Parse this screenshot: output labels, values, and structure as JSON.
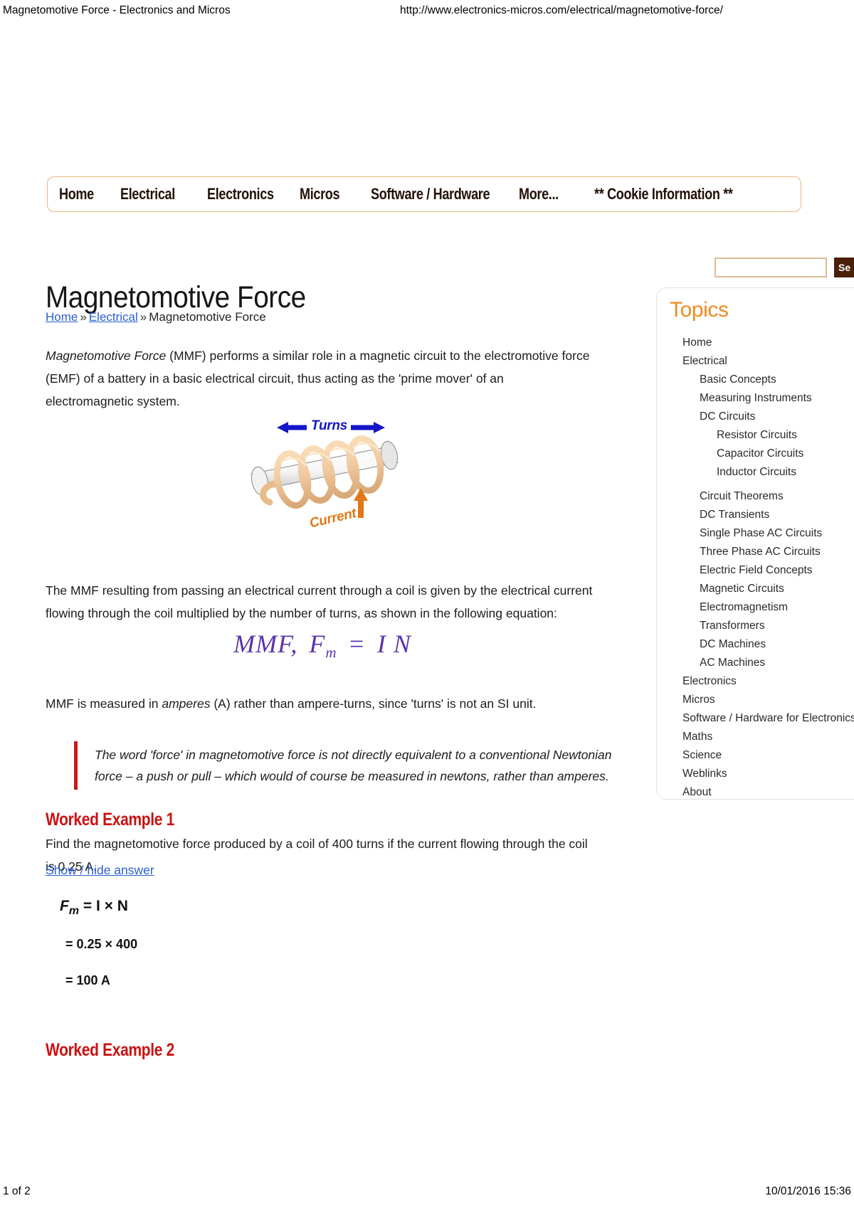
{
  "print": {
    "header_title": "Magnetomotive Force - Electronics and Micros",
    "header_url": "http://www.electronics-micros.com/electrical/magnetomotive-force/",
    "footer_page": "1 of 2",
    "footer_date": "10/01/2016 15:36"
  },
  "nav": {
    "items": [
      {
        "label": "Home"
      },
      {
        "label": "Electrical"
      },
      {
        "label": "Electronics"
      },
      {
        "label": "Micros"
      },
      {
        "label": "Software / Hardware"
      },
      {
        "label": "More..."
      },
      {
        "label": "** Cookie Information **"
      }
    ]
  },
  "main": {
    "title": "Magnetomotive Force",
    "breadcrumb": {
      "home": "Home",
      "sep1": "»",
      "electrical": "Electrical",
      "sep2": "»",
      "current": "Magnetomotive Force"
    },
    "intro_italic": "Magnetomotive Force",
    "intro_rest": " (MMF) performs a similar role in a magnetic circuit to the electromotive force (EMF) of a battery in a basic electrical circuit, thus acting as the 'prime mover' of an electromagnetic system.",
    "figure": {
      "turns_label": "Turns",
      "current_label": "Current"
    },
    "para_result": "The MMF resulting from passing an electrical current through a coil is given by the electrical current flowing through the coil multiplied by the number of turns, as shown in the following equation:",
    "equation": {
      "lhs": "MMF,",
      "symbol": "F",
      "subscript": "m",
      "equals": "=",
      "rhs": "I N"
    },
    "para_amperes_pre": "MMF is measured in ",
    "para_amperes_italic": "amperes",
    "para_amperes_post": " (A) rather than ampere-turns, since 'turns' is not an SI unit.",
    "note": "The word 'force' in magnetomotive force is not directly equivalent to a conventional Newtonian force – a push or pull – which would of course be measured in newtons, rather than amperes.",
    "worked_example_1": {
      "heading": "Worked Example 1",
      "question": "Find the magnetomotive force produced by a coil of 400 turns if the current flowing through the coil is 0.25 A.",
      "toggle": "Show / hide answer",
      "answer_symbol": "F",
      "answer_subscript": "m",
      "answer_formula": " = I × N",
      "answer_step2": "= 0.25 × 400",
      "answer_step3": "= 100 A"
    },
    "worked_example_2": {
      "heading": "Worked Example 2"
    }
  },
  "sidebar": {
    "search": {
      "value": "",
      "placeholder": "",
      "button_label": "Se"
    },
    "title": "Topics",
    "items": [
      {
        "label": "Home",
        "level": 0,
        "gap": false
      },
      {
        "label": "Electrical",
        "level": 0,
        "gap": false
      },
      {
        "label": "Basic Concepts",
        "level": 1,
        "gap": false
      },
      {
        "label": "Measuring Instruments",
        "level": 1,
        "gap": false
      },
      {
        "label": "DC Circuits",
        "level": 1,
        "gap": false
      },
      {
        "label": "Resistor Circuits",
        "level": 2,
        "gap": false
      },
      {
        "label": "Capacitor Circuits",
        "level": 2,
        "gap": false
      },
      {
        "label": "Inductor Circuits",
        "level": 2,
        "gap": false
      },
      {
        "label": "Circuit Theorems",
        "level": 1,
        "gap": true
      },
      {
        "label": "DC Transients",
        "level": 1,
        "gap": false
      },
      {
        "label": "Single Phase AC Circuits",
        "level": 1,
        "gap": false
      },
      {
        "label": "Three Phase AC Circuits",
        "level": 1,
        "gap": false
      },
      {
        "label": "Electric Field Concepts",
        "level": 1,
        "gap": false
      },
      {
        "label": "Magnetic Circuits",
        "level": 1,
        "gap": false
      },
      {
        "label": "Electromagnetism",
        "level": 1,
        "gap": false
      },
      {
        "label": "Transformers",
        "level": 1,
        "gap": false
      },
      {
        "label": "DC Machines",
        "level": 1,
        "gap": false
      },
      {
        "label": "AC Machines",
        "level": 1,
        "gap": false
      },
      {
        "label": "Electronics",
        "level": 0,
        "gap": false
      },
      {
        "label": "Micros",
        "level": 0,
        "gap": false
      },
      {
        "label": "Software / Hardware for Electronics",
        "level": 0,
        "gap": false
      },
      {
        "label": "Maths",
        "level": 0,
        "gap": false
      },
      {
        "label": "Science",
        "level": 0,
        "gap": false
      },
      {
        "label": "Weblinks",
        "level": 0,
        "gap": false
      },
      {
        "label": "About",
        "level": 0,
        "gap": false
      }
    ]
  },
  "colors": {
    "accent_orange": "#f08a1e",
    "heading_red": "#cc1111",
    "link_blue": "#2c5fd4",
    "equation_purple": "#5b33b0",
    "nav_border": "#e8b87a",
    "button_brown": "#4a2009"
  }
}
